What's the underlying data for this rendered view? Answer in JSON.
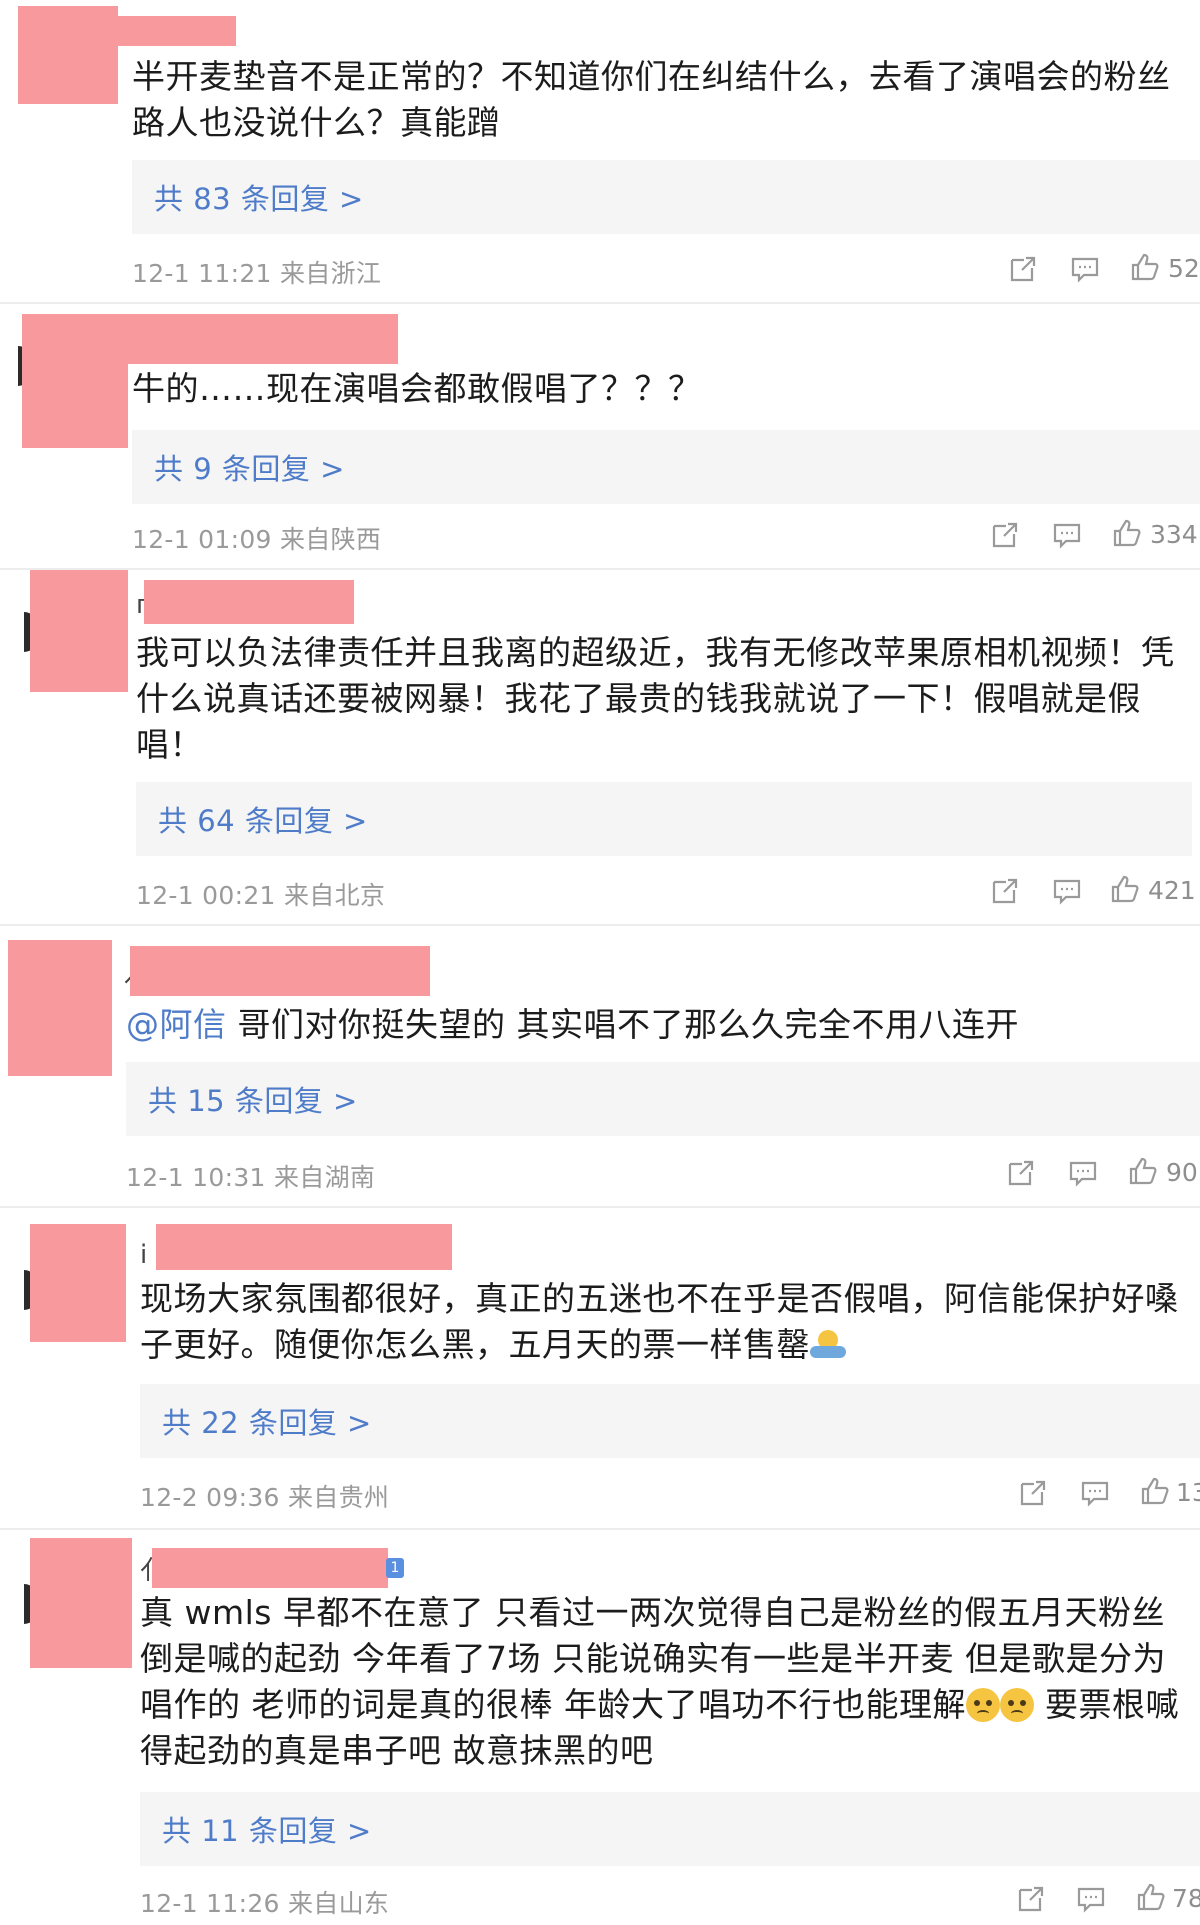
{
  "comments": [
    {
      "name_peek": "",
      "text": "半开麦垫音不是正常的？不知道你们在纠结什么，去看了演唱会的粉丝路人也没说什么？真能蹭",
      "replies": "共 83 条回复 >",
      "meta": "12-1 11:21 来自浙江",
      "likes": "52"
    },
    {
      "name_peek": "",
      "text": "牛的……现在演唱会都敢假唱了？？？",
      "replies": "共 9 条回复 >",
      "meta": "12-1 01:09 来自陕西",
      "likes": "334"
    },
    {
      "name_peek": "п",
      "text": "我可以负法律责任并且我离的超级近，我有无修改苹果原相机视频！凭什么说真话还要被网暴！我花了最贵的钱我就说了一下！假唱就是假唱！",
      "replies": "共 64 条回复 >",
      "meta": "12-1 00:21 来自北京",
      "likes": "421"
    },
    {
      "name_peek": "亻",
      "mention": "@阿信",
      "text": " 哥们对你挺失望的 其实唱不了那么久完全不用八连开",
      "replies": "共 15 条回复 >",
      "meta": "12-1 10:31 来自湖南",
      "likes": "90"
    },
    {
      "name_peek": "i",
      "text": "现场大家氛围都很好，真正的五迷也不在乎是否假唱，阿信能保护好嗓子更好。随便你怎么黑，五月天的票一样售罄",
      "replies": "共 22 条回复 >",
      "meta": "12-2 09:36 来自贵州",
      "likes": "13"
    },
    {
      "name_peek": "亻",
      "badge": "1",
      "text": "真 wmls 早都不在意了  只看过一两次觉得自己是粉丝的假五月天粉丝倒是喊的起劲  今年看了7场 只能说确实有一些是半开麦 但是歌是分为唱作的 老师的词是真的很棒 年龄大了唱功不行也能理解",
      "text_tail": " 要票根喊得起劲的真是串子吧 故意抹黑的吧",
      "replies": "共 11 条回复 >",
      "meta": "12-1 11:26 来自山东",
      "likes": "78"
    }
  ],
  "icons": [
    "share-icon",
    "comment-icon",
    "like-icon"
  ]
}
